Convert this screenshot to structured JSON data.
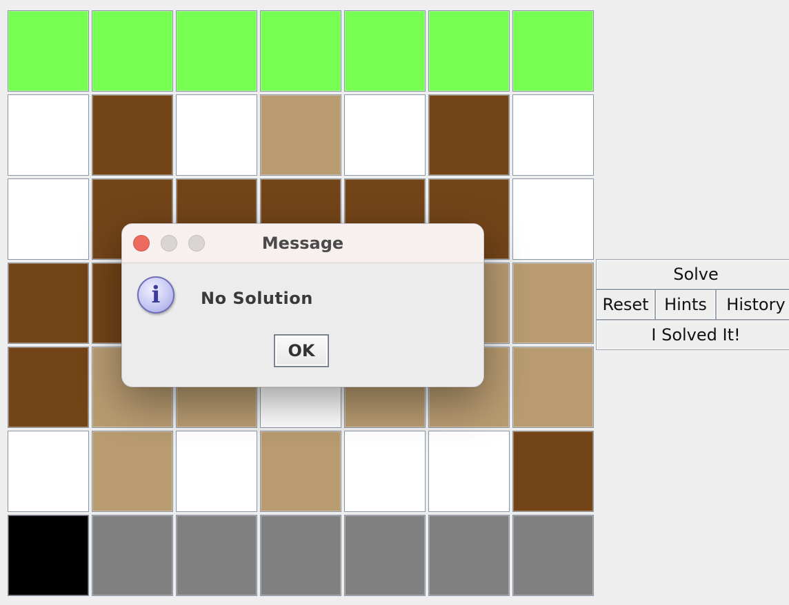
{
  "board": {
    "rows": [
      [
        "green",
        "green",
        "green",
        "green",
        "green",
        "green",
        "green"
      ],
      [
        "white",
        "dark-brown",
        "white",
        "tan",
        "white",
        "dark-brown",
        "white"
      ],
      [
        "white",
        "dark-brown",
        "dark-brown",
        "dark-brown",
        "dark-brown",
        "dark-brown",
        "white"
      ],
      [
        "dark-brown",
        "dark-brown",
        "tan",
        "tan",
        "tan",
        "tan",
        "tan"
      ],
      [
        "dark-brown",
        "tan",
        "tan",
        "white",
        "tan",
        "tan",
        "tan"
      ],
      [
        "white",
        "tan",
        "white",
        "tan",
        "white",
        "white",
        "dark-brown"
      ],
      [
        "black",
        "gray",
        "gray",
        "gray",
        "gray",
        "gray",
        "gray"
      ]
    ],
    "palette": {
      "green": "#77fe52",
      "white": "#ffffff",
      "dark-brown": "#734418",
      "tan": "#b89b70",
      "black": "#000000",
      "gray": "#808080"
    }
  },
  "controls": {
    "solve_label": "Solve",
    "reset_label": "Reset",
    "hints_label": "Hints",
    "history_label": "History",
    "solved_label": "I Solved It!"
  },
  "dialog": {
    "title": "Message",
    "message": "No Solution",
    "ok_label": "OK",
    "icon": "info-icon",
    "traffic_lights": {
      "close": "#ed6a5e",
      "minimize": "#d8d5d3",
      "zoom": "#d8d5d3"
    }
  }
}
